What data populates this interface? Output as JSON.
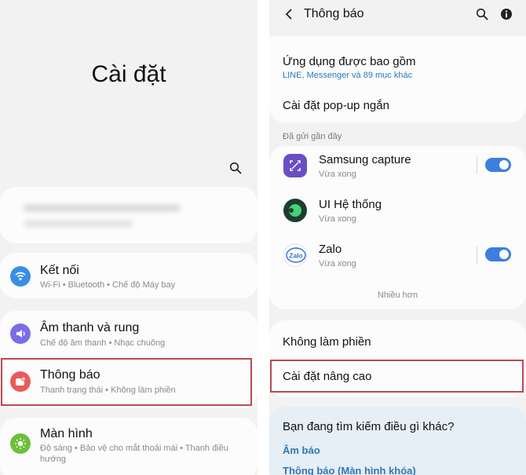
{
  "left": {
    "title": "Cài đặt",
    "search_icon": "search-icon",
    "items": [
      {
        "title": "Kết nối",
        "subtitle": "Wi-Fi • Bluetooth • Chế độ Máy bay",
        "icon": "wifi-icon",
        "color": "#3a8ee6"
      },
      {
        "title": "Âm thanh và rung",
        "subtitle": "Chế độ âm thanh • Nhạc chuông",
        "icon": "speaker-icon",
        "color": "#7a6ee6"
      },
      {
        "title": "Thông báo",
        "subtitle": "Thanh trạng thái • Không làm phiền",
        "icon": "notification-icon",
        "color": "#ea5a5a"
      },
      {
        "title": "Màn hình",
        "subtitle_line1": "Độ sáng • Bảo vệ cho mắt thoải mái • Thanh điều",
        "subtitle_line2": "hướng",
        "icon": "sun-icon",
        "color": "#6dbf3a"
      }
    ]
  },
  "right": {
    "header": {
      "title": "Thông báo",
      "back_icon": "back-arrow-icon",
      "search_icon": "search-icon",
      "info_icon": "info-icon"
    },
    "included_apps": {
      "title": "Ứng dụng được bao gồm",
      "subtitle": "LINE, Messenger và 89 mục khác"
    },
    "popup": {
      "title": "Cài đặt pop-up ngắn"
    },
    "recent_label": "Đã gửi gần đây",
    "apps": [
      {
        "name": "Samsung capture",
        "time": "Vừa xong",
        "toggle": true,
        "color": "#6a4fc4"
      },
      {
        "name": "UI Hệ thống",
        "time": "Vừa xong",
        "toggle": false,
        "color": "#1f3d2c"
      },
      {
        "name": "Zalo",
        "time": "Vừa xong",
        "toggle": true,
        "color": "#ffffff"
      }
    ],
    "more_label": "Nhiều hơn",
    "dnd": {
      "title": "Không làm phiền"
    },
    "advanced": {
      "title": "Cài đặt nâng cao"
    },
    "search_suggest": {
      "question": "Bạn đang tìm kiếm điều gì khác?",
      "links": [
        "Âm báo",
        "Thông báo (Màn hình khóa)"
      ]
    }
  },
  "colors": {
    "highlight": "#b94a4f",
    "toggle_on": "#3d7fe0",
    "link": "#2f78b5"
  }
}
